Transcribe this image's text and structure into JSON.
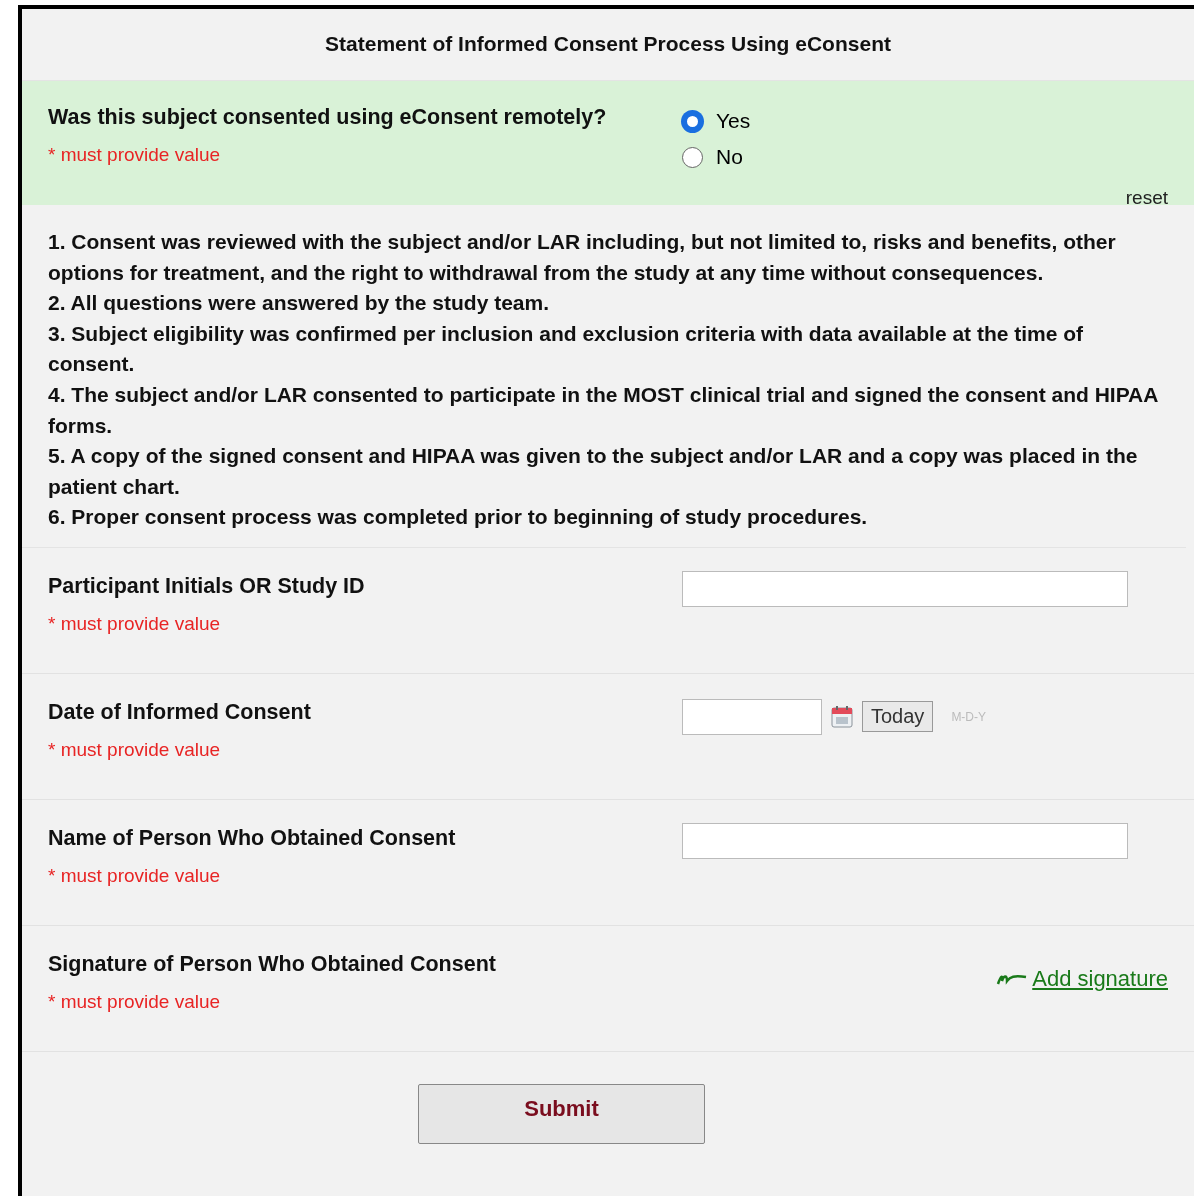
{
  "form": {
    "title": "Statement of Informed Consent Process Using eConsent",
    "question": {
      "label": "Was this subject consented using eConsent remotely?",
      "required_note": "* must provide value",
      "options": [
        {
          "label": "Yes",
          "selected": true
        },
        {
          "label": "No",
          "selected": false
        }
      ],
      "reset": "reset"
    },
    "statements": [
      "1. Consent was reviewed with the subject and/or LAR including, but not limited to, risks and benefits, other options for treatment, and the right to withdrawal from the study at any time without consequences.",
      "2. All questions were answered by the study team.",
      "3. Subject eligibility was confirmed per inclusion and exclusion criteria with data available at the time of consent.",
      "4. The subject and/or LAR consented to participate in the MOST clinical trial and signed the consent and HIPAA forms.",
      "5. A copy of the signed consent and HIPAA was given to the subject and/or LAR and a copy was placed in the patient chart.",
      "6. Proper consent process was completed prior to beginning of study procedures."
    ],
    "fields": [
      {
        "kind": "text",
        "label": "Participant Initials OR Study ID",
        "required_note": "* must provide value"
      },
      {
        "kind": "date",
        "label": "Date of Informed Consent",
        "required_note": "* must provide value",
        "button": "Today",
        "format": "M-D-Y"
      },
      {
        "kind": "text",
        "label": "Name of Person Who Obtained Consent",
        "required_note": "* must provide value"
      },
      {
        "kind": "signature",
        "label": "Signature of Person Who Obtained Consent",
        "required_note": "* must provide value",
        "link": "Add signature"
      }
    ],
    "submit": "Submit"
  }
}
